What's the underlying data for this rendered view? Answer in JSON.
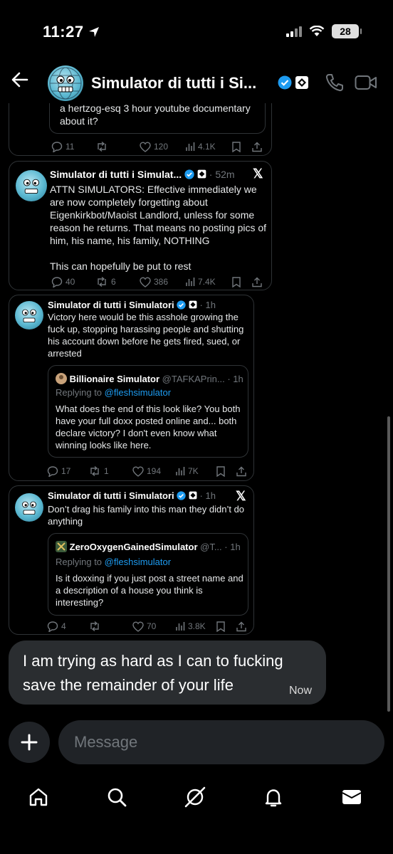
{
  "status": {
    "time": "11:27",
    "battery": "28"
  },
  "header": {
    "title": "Simulator di tutti i Si..."
  },
  "posts": [
    {
      "quote_tail": "a hertzog-esq 3 hour youtube documentary\nabout it?",
      "replies": "11",
      "reposts": "",
      "likes": "120",
      "views": "4.1K"
    },
    {
      "author": "Simulator di tutti i Simulat...",
      "time": "· 52m",
      "body": "ATTN SIMULATORS: Effective immediately we are now completely forgetting about Eigenkirkbot/Maoist Landlord, unless for some reason he returns. That means no posting pics of him, his name, his family, NOTHING\n\nThis can hopefully be put to rest",
      "replies": "40",
      "reposts": "6",
      "likes": "386",
      "views": "7.4K"
    },
    {
      "author": "Simulator di tutti i Simulatori",
      "time": "· 1h",
      "body": "Victory here would be this asshole growing the fuck up, stopping harassing people and shutting his account down before he gets fired, sued, or arrested",
      "quote": {
        "author": "Billionaire Simulator",
        "handle": "@TAFKAPrin... · 1h",
        "replying_prefix": "Replying to",
        "replying_to": "@fleshsimulator",
        "body": "What does the end of this look like? You both have your full doxx posted online and... both declare victory? I don't even know what winning looks like here."
      },
      "replies": "17",
      "reposts": "1",
      "likes": "194",
      "views": "7K"
    },
    {
      "author": "Simulator di tutti i Simulatori",
      "time": "· 1h",
      "body": "Don’t drag his family into this man they didn’t do anything",
      "quote": {
        "author": "ZeroOxygenGainedSimulator",
        "handle": "@T... · 1h",
        "replying_prefix": "Replying to",
        "replying_to": "@fleshsimulator",
        "body": "Is it doxxing if you just post a street name and a description of a house you think is interesting?"
      },
      "replies": "4",
      "reposts": "",
      "likes": "70",
      "views": "3.8K"
    }
  ],
  "my_message": {
    "text": "I am trying as hard as I can to fucking save the remainder of your life",
    "time": "Now"
  },
  "composer": {
    "placeholder": "Message"
  },
  "x_glyph": "𝕏",
  "colors": {
    "accent": "#1d9bf0",
    "verified": "#1d9bf0",
    "bg": "#000000",
    "muted": "#71767b",
    "bubble": "#2a2d30"
  },
  "icons": [
    "back-arrow-icon",
    "verified-icon",
    "phone-icon",
    "video-icon",
    "reply-icon",
    "repost-icon",
    "like-icon",
    "views-icon",
    "bookmark-icon",
    "share-icon",
    "plus-icon",
    "home-icon",
    "search-icon",
    "grok-icon",
    "bell-icon",
    "mail-icon"
  ]
}
